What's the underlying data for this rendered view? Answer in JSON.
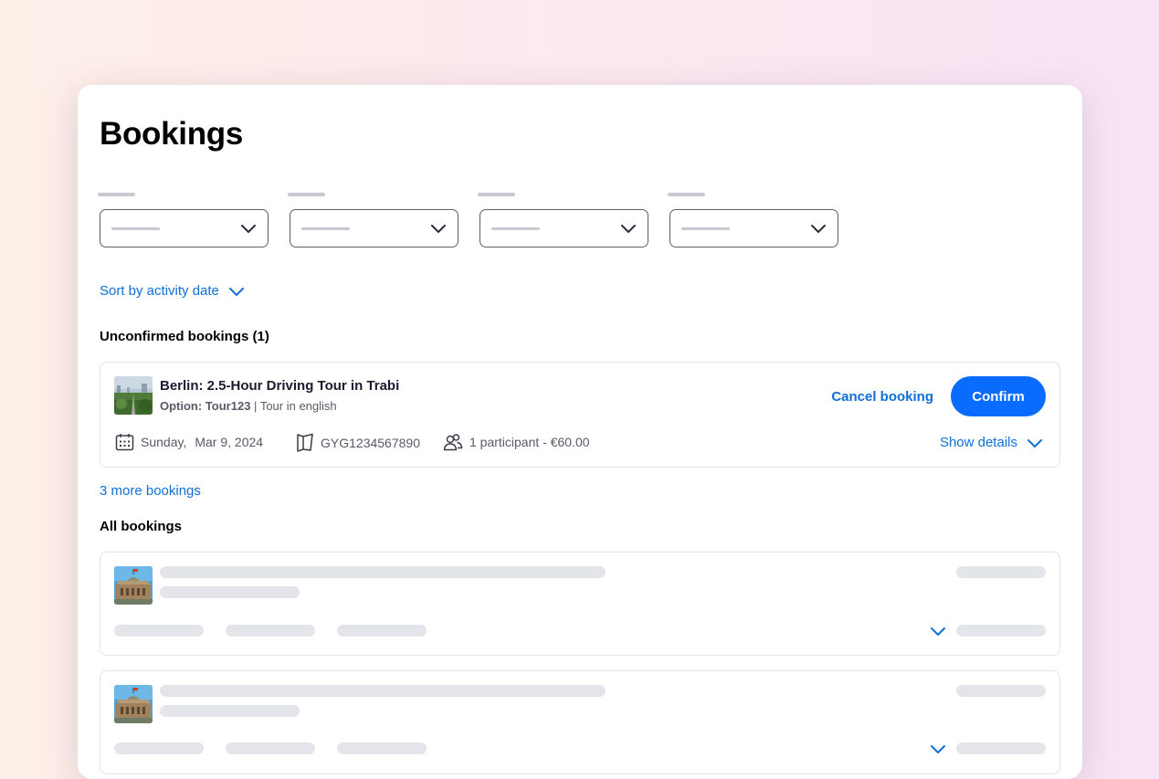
{
  "page": {
    "title": "Bookings"
  },
  "sort": {
    "label": "Sort by activity date"
  },
  "unconfirmed": {
    "heading": "Unconfirmed bookings (1)",
    "booking": {
      "title": "Berlin: 2.5-Hour Driving Tour in Trabi",
      "option_label": "Option: Tour123",
      "option_separator": " | ",
      "option_detail": "Tour in english",
      "cancel_label": "Cancel booking",
      "confirm_label": "Confirm",
      "date_day": "Sunday,",
      "date": "Mar 9, 2024",
      "reference": "GYG1234567890",
      "participants": "1 participant - €60.00",
      "details_label": "Show details"
    },
    "more_label": "3 more bookings"
  },
  "all": {
    "heading": "All bookings"
  },
  "colors": {
    "accent": "#0a6cff",
    "link": "#0f6fd7",
    "skeleton": "#e3e5ea"
  }
}
